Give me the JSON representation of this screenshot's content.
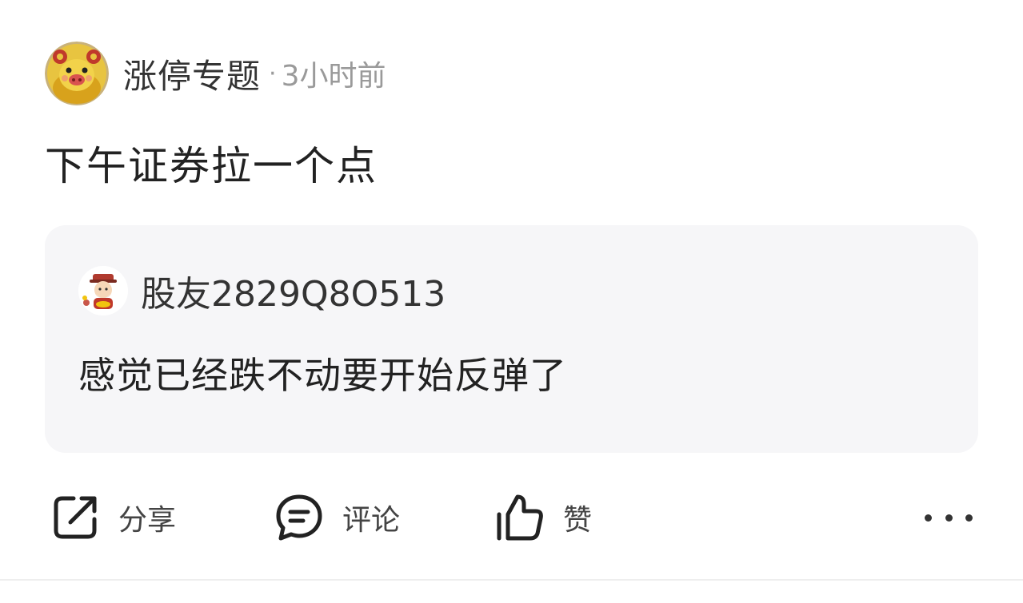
{
  "post": {
    "author": "涨停专题",
    "separator": "·",
    "time": "3小时前",
    "text": "下午证券拉一个点"
  },
  "quoted": {
    "author": "股友2829Q8O513",
    "text": "感觉已经跌不动要开始反弹了"
  },
  "actions": {
    "share_label": "分享",
    "share_icon": "share-icon",
    "comment_label": "评论",
    "comment_icon": "comment-icon",
    "like_label": "赞",
    "like_icon": "thumbs-up-icon",
    "more_icon": "more-icon"
  },
  "colors": {
    "quote_background": "#f6f6f8",
    "meta_gray": "#9a9a9a",
    "text_dark": "#222222"
  }
}
